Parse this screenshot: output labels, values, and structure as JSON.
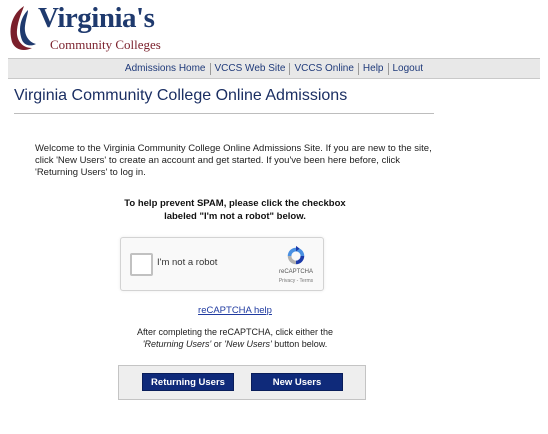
{
  "logo": {
    "title": "Virginia's",
    "subtitle": "Community Colleges"
  },
  "nav": {
    "items": [
      "Admissions Home",
      "VCCS Web Site",
      "VCCS Online",
      "Help",
      "Logout"
    ]
  },
  "page": {
    "title": "Virginia Community College Online Admissions"
  },
  "intro": {
    "text": "Welcome to the Virginia Community College Online Admissions Site. If you are new to the site, click 'New Users' to create an account and get started. If you've been here before, click 'Returning Users' to log in."
  },
  "spam": {
    "line1": "To help prevent SPAM, please click the checkbox",
    "line2": "labeled \"I'm not a robot\" below."
  },
  "recaptcha": {
    "label": "I'm not a robot",
    "brand": "reCAPTCHA",
    "terms": "Privacy - Terms",
    "checked": false
  },
  "help_link": "reCAPTCHA help",
  "after": {
    "line1": "After completing the reCAPTCHA, click either the",
    "returning": "'Returning Users'",
    "or": " or ",
    "new": "'New Users'",
    "end": " button below."
  },
  "buttons": {
    "returning": "Returning Users",
    "new": "New Users"
  },
  "colors": {
    "nav_link": "#1f3a7a",
    "button_bg": "#0f2a7a",
    "title": "#1b2f63",
    "logo_red": "#7a1f2b"
  }
}
